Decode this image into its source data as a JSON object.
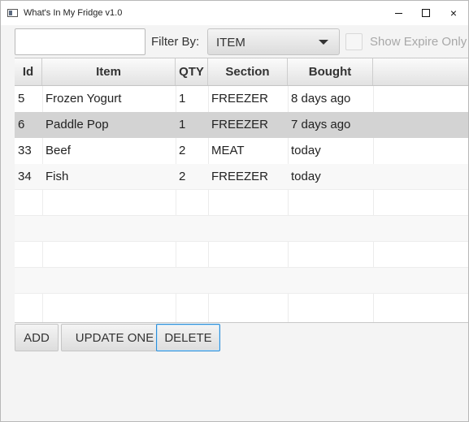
{
  "window": {
    "title": "What's In My Fridge v1.0",
    "controls": {
      "minimize": "–",
      "maximize": "□",
      "close": "×"
    }
  },
  "toolbar": {
    "search": {
      "value": "",
      "placeholder": ""
    },
    "filter_label": "Filter By:",
    "filter_value": "ITEM",
    "filter_options": [
      "ITEM"
    ],
    "expire_checkbox": {
      "label": "Show Expire Only",
      "checked": false,
      "disabled": true
    }
  },
  "table": {
    "columns": [
      "Id",
      "Item",
      "QTY",
      "Section",
      "Bought"
    ],
    "rows": [
      [
        "5",
        "Frozen Yogurt",
        "1",
        "FREEZER",
        "8 days ago"
      ],
      [
        "6",
        "Paddle Pop",
        "1",
        "FREEZER",
        "7 days ago"
      ],
      [
        "33",
        "Beef",
        "2",
        "MEAT",
        "today"
      ],
      [
        "34",
        "Fish",
        "2",
        "FREEZER",
        "today"
      ]
    ],
    "selected_row": 1
  },
  "actions": {
    "add": "ADD",
    "update": "UPDATE ONE",
    "delete": "DELETE"
  },
  "colors": {
    "selected_row": "#d3d3d3",
    "focus_border": "#2d8ed8"
  }
}
